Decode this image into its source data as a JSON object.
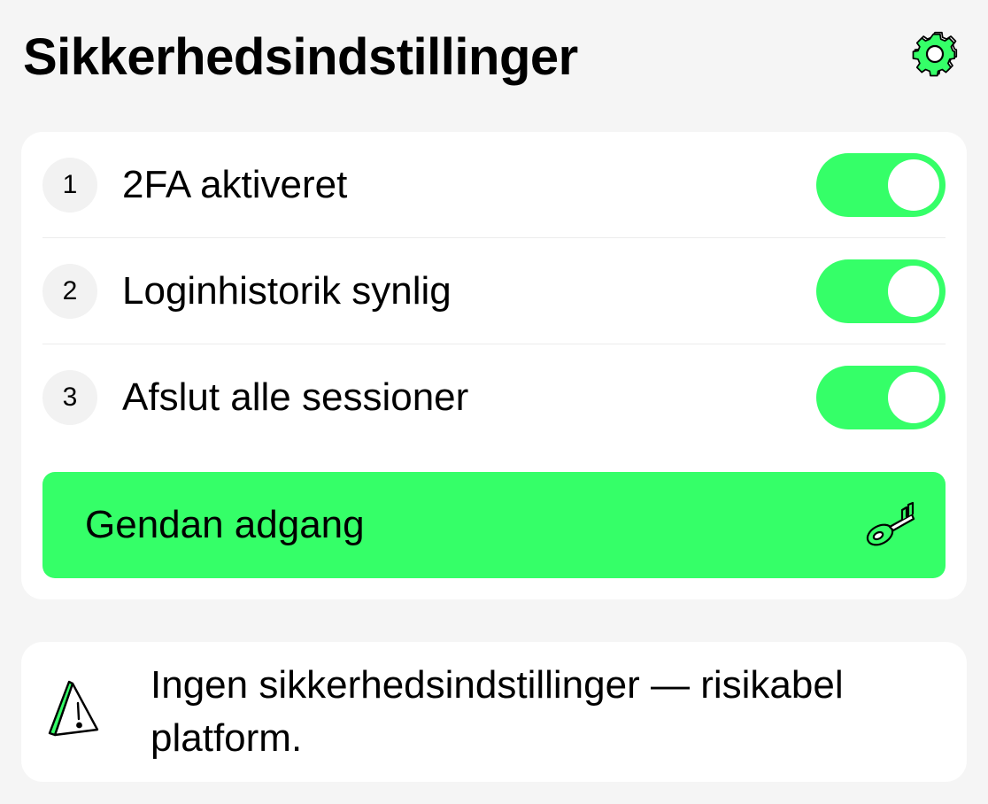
{
  "header": {
    "title": "Sikkerhedsindstillinger",
    "settings_icon": "gear-icon"
  },
  "settings": {
    "items": [
      {
        "number": "1",
        "label": "2FA aktiveret",
        "enabled": true
      },
      {
        "number": "2",
        "label": "Loginhistorik synlig",
        "enabled": true
      },
      {
        "number": "3",
        "label": "Afslut alle sessioner",
        "enabled": true
      }
    ],
    "restore_button": {
      "label": "Gendan adgang",
      "icon": "key-icon"
    }
  },
  "warning": {
    "icon": "warning-icon",
    "text": "Ingen sikkerhedsindstillinger — risikabel platform."
  },
  "colors": {
    "accent": "#35ff68",
    "background": "#f5f5f5",
    "card": "#ffffff",
    "icon_stroke": "#000000"
  }
}
